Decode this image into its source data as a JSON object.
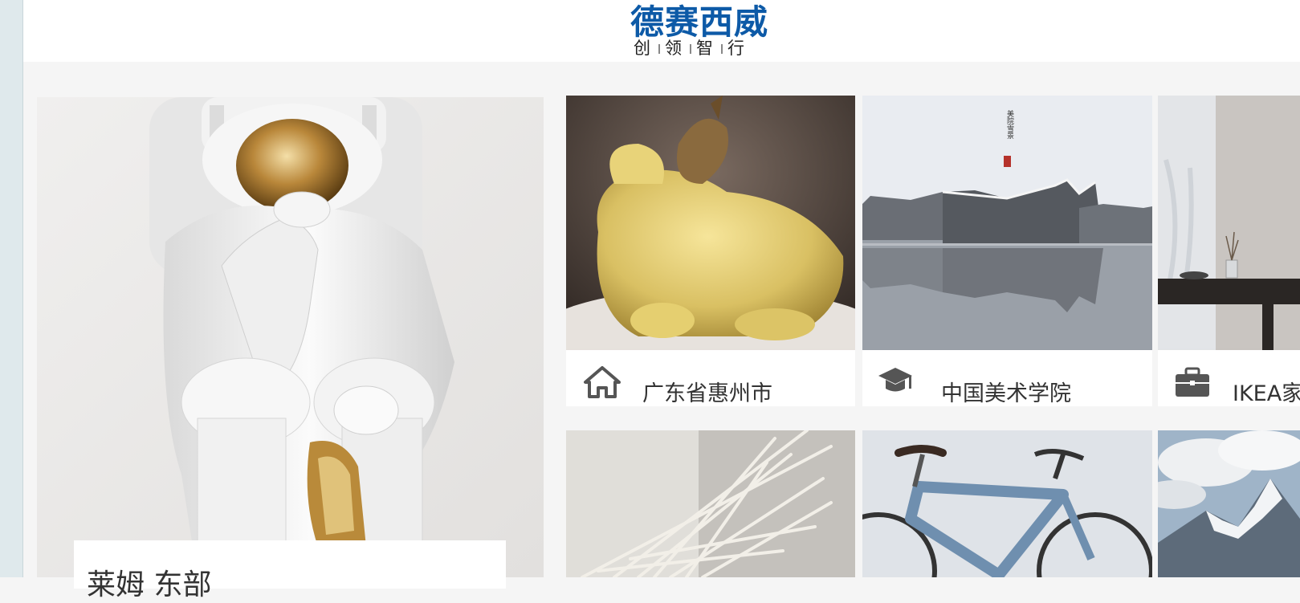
{
  "logo": {
    "brand": "德赛西威",
    "tagline": [
      "创",
      "领",
      "智",
      "行"
    ],
    "brand_color": "#0d5aa7"
  },
  "feature": {
    "label": "莱姆 东部"
  },
  "tiles": [
    {
      "label": "广东省惠州市",
      "icon": "house-icon"
    },
    {
      "label": "中国美术学院",
      "icon": "graduation-cap-icon"
    },
    {
      "label": "IKEA家",
      "icon": "briefcase-icon"
    }
  ],
  "poster_text": {
    "title": "美院雪景"
  }
}
